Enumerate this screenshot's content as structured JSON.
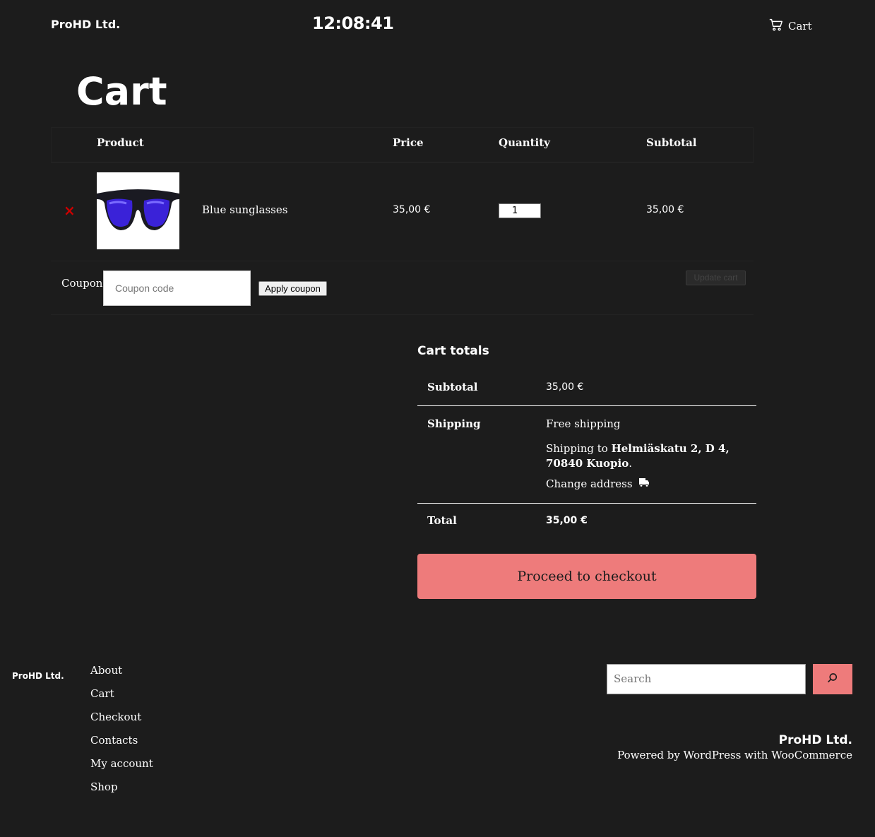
{
  "header": {
    "site_title": "ProHD Ltd.",
    "clock": "12:08:41",
    "cart_label": "Cart"
  },
  "page": {
    "title": "Cart"
  },
  "cart_table": {
    "headers": {
      "product": "Product",
      "price": "Price",
      "quantity": "Quantity",
      "subtotal": "Subtotal"
    },
    "items": [
      {
        "remove": "×",
        "name": "Blue sunglasses",
        "price": "35,00 €",
        "quantity": "1",
        "subtotal": "35,00 €"
      }
    ],
    "coupon_label": "Coupon:",
    "coupon_placeholder": "Coupon code",
    "apply_coupon": "Apply coupon",
    "update_cart": "Update cart"
  },
  "totals": {
    "title": "Cart totals",
    "subtotal_label": "Subtotal",
    "subtotal_value": "35,00 €",
    "shipping_label": "Shipping",
    "shipping_method": "Free shipping",
    "shipping_to_prefix": "Shipping to ",
    "shipping_address": "Helmiäskatu 2, D 4, 70840 Kuopio",
    "shipping_suffix": ".",
    "change_address": "Change address",
    "total_label": "Total",
    "total_value": "35,00 €",
    "checkout_button": "Proceed to checkout"
  },
  "footer": {
    "logo": "ProHD Ltd.",
    "nav": [
      "About",
      "Cart",
      "Checkout",
      "Contacts",
      "My account",
      "Shop"
    ],
    "search_placeholder": "Search",
    "brand": "ProHD Ltd.",
    "powered_prefix": "Powered by ",
    "wordpress": "WordPress",
    "with": " with ",
    "woocommerce": "WooCommerce"
  },
  "colors": {
    "background": "#1c1c1c",
    "accent": "#ee7b7b",
    "remove": "#cc0000"
  }
}
